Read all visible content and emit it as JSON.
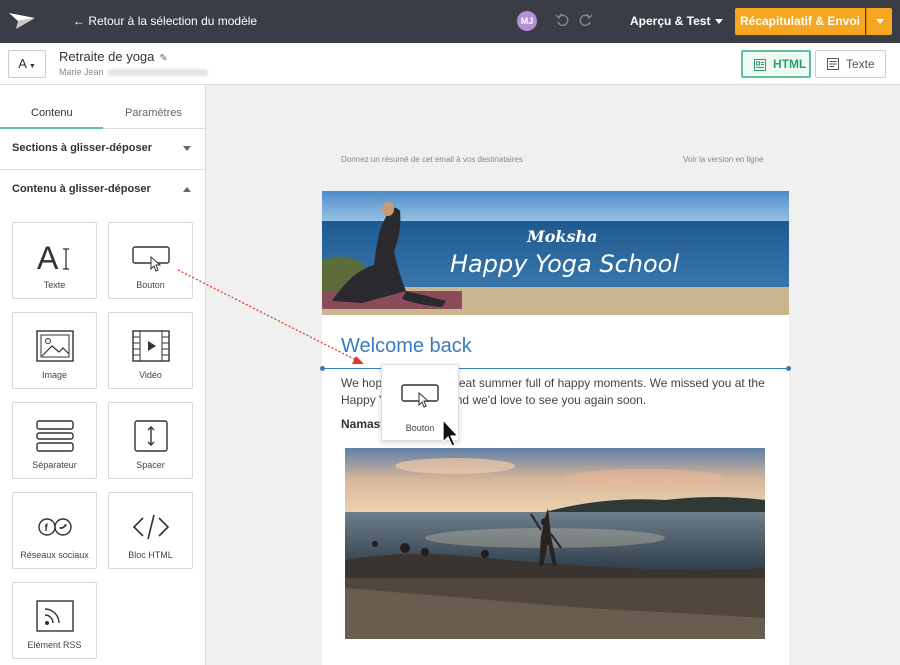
{
  "topbar": {
    "back_label": "← Retour à la sélection du modèle",
    "avatar_initials": "MJ",
    "preview_label": "Aperçu & Test",
    "primary_label": "Récapitulatif & Envoi",
    "icons": [
      "logo-icon",
      "undo-icon",
      "redo-icon",
      "chevron-down-icon"
    ]
  },
  "subbar": {
    "variant": "A",
    "campaign_name": "Retraite de yoga",
    "sender_name": "Marie Jean",
    "html_label": "HTML",
    "text_label": "Texte"
  },
  "sidebar": {
    "tabs": [
      {
        "label": "Contenu"
      },
      {
        "label": "Paramètres"
      }
    ],
    "sections": [
      {
        "label": "Sections à glisser-déposer"
      },
      {
        "label": "Contenu à glisser-déposer"
      }
    ],
    "tiles": [
      {
        "label": "Texte",
        "icon": "text-icon"
      },
      {
        "label": "Bouton",
        "icon": "button-icon"
      },
      {
        "label": "Image",
        "icon": "image-icon"
      },
      {
        "label": "Vidéo",
        "icon": "video-icon"
      },
      {
        "label": "Séparateur",
        "icon": "divider-icon"
      },
      {
        "label": "Spacer",
        "icon": "spacer-icon"
      },
      {
        "label": "Réseaux sociaux",
        "icon": "social-icon"
      },
      {
        "label": "Bloc HTML",
        "icon": "code-icon"
      },
      {
        "label": "Elément RSS",
        "icon": "rss-icon"
      }
    ]
  },
  "email": {
    "preheader": "Donnez un résumé de cet email à vos destinataires",
    "view_online": "Voir la version en ligne",
    "hero_subtitle": "Moksha",
    "hero_title": "Happy Yoga School",
    "heading": "Welcome back",
    "body": "We hope you had a great summer full of happy moments. We missed you at the Happy Yoga School and we'd love to see you again soon.",
    "signature": "Namaste"
  },
  "drag": {
    "ghost_label": "Bouton"
  },
  "colors": {
    "topbar": "#3a3d45",
    "accent_green": "#5fc29b",
    "primary_orange": "#f5a623",
    "link_blue": "#3a7bbf",
    "avatar": "#b190d6",
    "drag_arrow": "#e03a2c"
  }
}
